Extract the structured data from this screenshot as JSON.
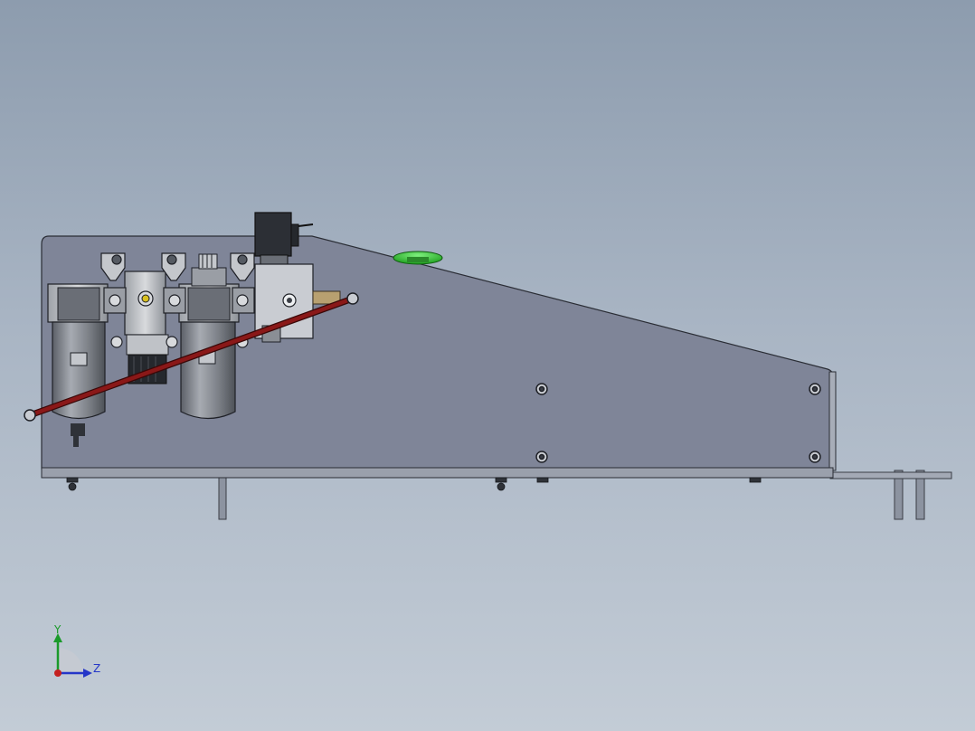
{
  "viewport": {
    "background_top": "#8d9cae",
    "background_bottom": "#c3ccd6"
  },
  "model": {
    "plate_color": "#7f8598",
    "edge_color": "#2a2d35",
    "tube_color": "#7a1414",
    "button_color": "#2fc42f",
    "bowl_color": "#7b7f86"
  },
  "triad": {
    "y_label": "Y",
    "z_label": "Z",
    "y_color": "#1a9a2a",
    "z_color": "#2436c8",
    "x_color": "#c42020"
  }
}
